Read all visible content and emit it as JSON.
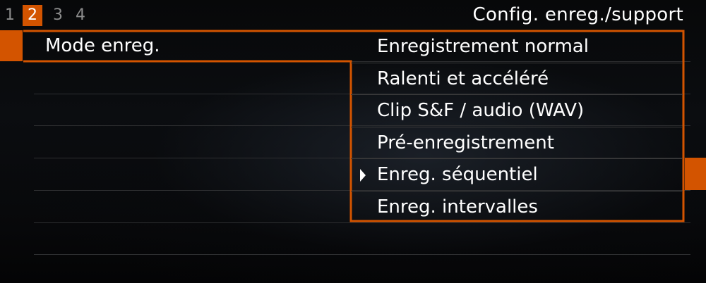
{
  "tabs": [
    {
      "label": "1"
    },
    {
      "label": "2"
    },
    {
      "label": "3"
    },
    {
      "label": "4"
    }
  ],
  "header": {
    "title": "Config. enreg./support"
  },
  "setting": {
    "label": "Mode enreg."
  },
  "options": [
    {
      "label": "Enregistrement normal"
    },
    {
      "label": "Ralenti et accéléré"
    },
    {
      "label": "Clip S&F / audio (WAV)"
    },
    {
      "label": "Pré-enregistrement"
    },
    {
      "label": "Enreg. séquentiel"
    },
    {
      "label": "Enreg. intervalles"
    }
  ],
  "current_option": "Enreg. séquentiel",
  "colors": {
    "accent": "#d35400",
    "text": "#ffffff",
    "tab_inactive": "#8c8c8c",
    "background": "#000000"
  },
  "icons": {
    "current_marker": "triangle-right-icon"
  }
}
